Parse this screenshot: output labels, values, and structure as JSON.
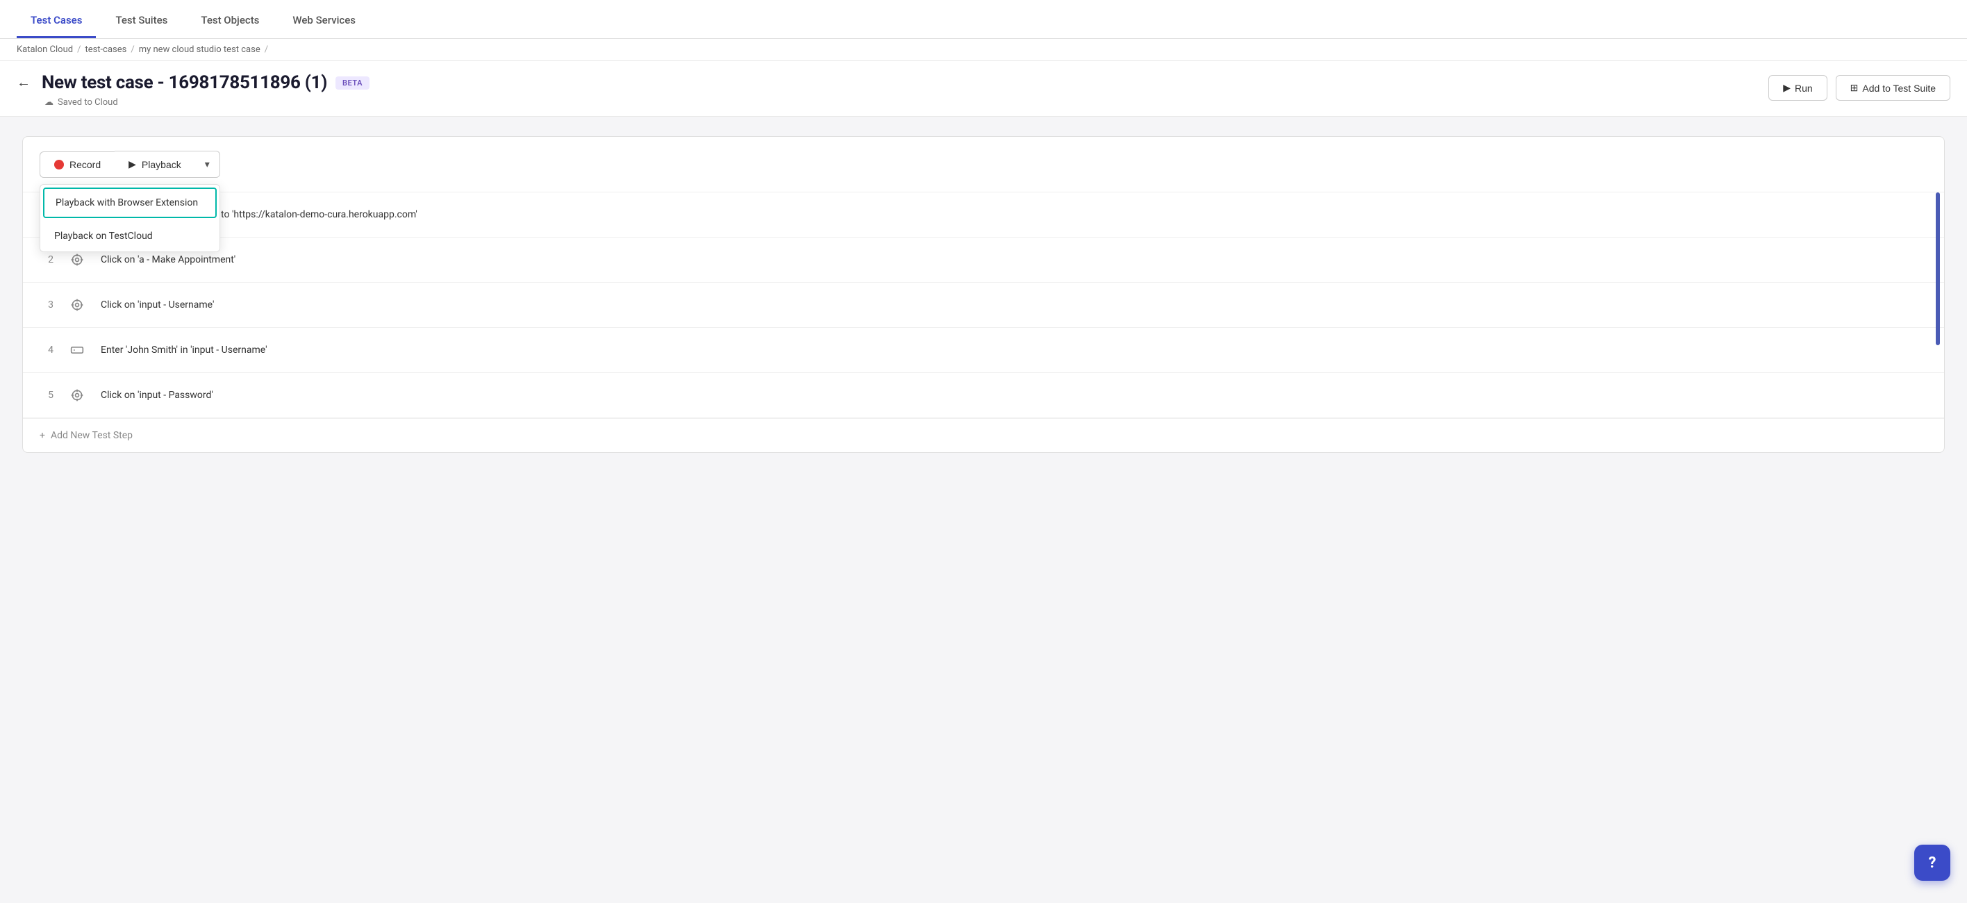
{
  "tabs": [
    {
      "id": "test-cases",
      "label": "Test Cases",
      "active": true
    },
    {
      "id": "test-suites",
      "label": "Test Suites",
      "active": false
    },
    {
      "id": "test-objects",
      "label": "Test Objects",
      "active": false
    },
    {
      "id": "web-services",
      "label": "Web Services",
      "active": false
    }
  ],
  "breadcrumb": {
    "items": [
      "Katalon Cloud",
      "test-cases",
      "my new cloud studio test case",
      ""
    ]
  },
  "header": {
    "back_label": "←",
    "title": "New test case - 1698178511896 (1)",
    "beta_label": "Beta",
    "saved_label": "Saved to Cloud",
    "run_label": "Run",
    "add_suite_label": "Add to Test Suite"
  },
  "toolbar": {
    "record_label": "Record",
    "playback_label": "Playback",
    "dropdown_icon": "▾"
  },
  "dropdown": {
    "items": [
      {
        "id": "browser-extension",
        "label": "Playback with Browser Extension",
        "highlighted": true
      },
      {
        "id": "testcloud",
        "label": "Playback on TestCloud",
        "highlighted": false
      }
    ]
  },
  "steps": [
    {
      "num": "",
      "icon": "target",
      "text": "Open browser and navigate to 'https://katalon-demo-cura.herokuapp.com'"
    },
    {
      "num": "2",
      "icon": "target",
      "text": "Click on 'a - Make Appointment'"
    },
    {
      "num": "3",
      "icon": "target",
      "text": "Click on 'input - Username'"
    },
    {
      "num": "4",
      "icon": "input",
      "text": "Enter 'John Smith' in 'input - Username'"
    },
    {
      "num": "5",
      "icon": "target",
      "text": "Click on 'input - Password'"
    }
  ],
  "add_step": {
    "label": "Add New Test Step"
  },
  "chat_btn": {
    "icon": "?"
  }
}
